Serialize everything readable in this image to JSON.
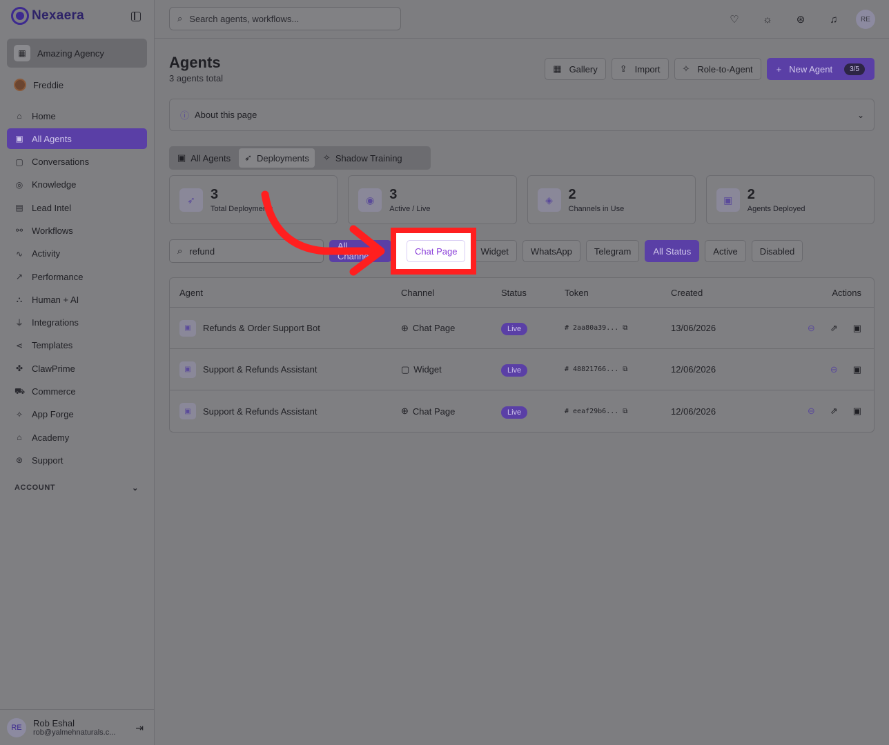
{
  "brand": {
    "name": "Nexaera"
  },
  "sidebar": {
    "workspace": "Amazing Agency",
    "user": "Freddie",
    "items": [
      {
        "label": "Home",
        "icon": "home-icon"
      },
      {
        "label": "All Agents",
        "icon": "bot-icon"
      },
      {
        "label": "Conversations",
        "icon": "chat-icon"
      },
      {
        "label": "Knowledge",
        "icon": "brain-icon"
      },
      {
        "label": "Lead Intel",
        "icon": "contact-icon"
      },
      {
        "label": "Workflows",
        "icon": "workflow-icon"
      },
      {
        "label": "Activity",
        "icon": "activity-icon"
      },
      {
        "label": "Performance",
        "icon": "trend-icon"
      },
      {
        "label": "Human + AI",
        "icon": "network-icon"
      },
      {
        "label": "Integrations",
        "icon": "plug-icon"
      },
      {
        "label": "Templates",
        "icon": "share-icon"
      },
      {
        "label": "ClawPrime",
        "icon": "paw-icon"
      },
      {
        "label": "Commerce",
        "icon": "cart-icon"
      },
      {
        "label": "App Forge",
        "icon": "sparkle-icon"
      },
      {
        "label": "Academy",
        "icon": "graduation-icon"
      },
      {
        "label": "Support",
        "icon": "lifebuoy-icon"
      }
    ],
    "active_index": 1,
    "account_label": "ACCOUNT",
    "footer": {
      "initials": "RE",
      "name": "Rob Eshal",
      "email": "rob@yalmehnaturals.c..."
    }
  },
  "topbar": {
    "search_placeholder": "Search agents, workflows...",
    "avatar": "RE"
  },
  "page": {
    "title": "Agents",
    "subtitle": "3 agents total",
    "buttons": {
      "gallery": "Gallery",
      "import": "Import",
      "role": "Role-to-Agent",
      "new_agent": "New Agent",
      "quota": "3/5"
    },
    "about": "About this page",
    "tabs": [
      "All Agents",
      "Deployments",
      "Shadow Training"
    ],
    "active_tab": 1
  },
  "stats": [
    {
      "value": "3",
      "label": "Total Deployments"
    },
    {
      "value": "3",
      "label": "Active / Live"
    },
    {
      "value": "2",
      "label": "Channels in Use"
    },
    {
      "value": "2",
      "label": "Agents Deployed"
    }
  ],
  "filters": {
    "search_value": "refund",
    "channel_all": "All Channels",
    "chips": [
      "Chat Page",
      "Widget",
      "WhatsApp",
      "Telegram"
    ],
    "status": [
      "All Status",
      "Active",
      "Disabled"
    ]
  },
  "table": {
    "headers": [
      "Agent",
      "Channel",
      "Status",
      "Token",
      "Created",
      "Actions"
    ],
    "rows": [
      {
        "agent": "Refunds & Order Support Bot",
        "channel": "Chat Page",
        "status": "Live",
        "token": "2aa80a39...",
        "created": "13/06/2026"
      },
      {
        "agent": "Support & Refunds Assistant",
        "channel": "Widget",
        "status": "Live",
        "token": "48821766...",
        "created": "12/06/2026"
      },
      {
        "agent": "Support & Refunds Assistant",
        "channel": "Chat Page",
        "status": "Live",
        "token": "eeaf29b6...",
        "created": "12/06/2026"
      }
    ]
  },
  "colors": {
    "accent": "#5a3fa6",
    "highlight": "#ff1f1f"
  }
}
